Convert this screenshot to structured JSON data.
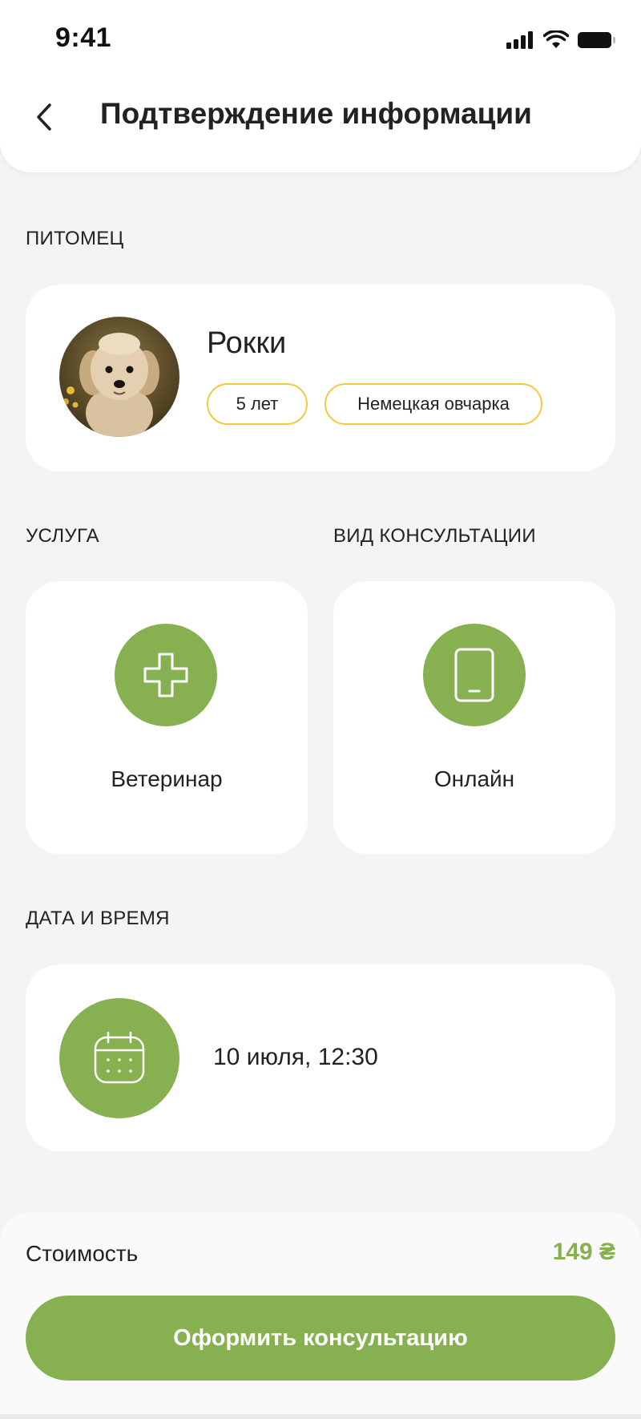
{
  "status_bar": {
    "time": "9:41"
  },
  "header": {
    "title": "Подтверждение информации"
  },
  "pet_section": {
    "label": "ПИТОМЕЦ",
    "name": "Рокки",
    "tags": [
      "5 лет",
      "Немецкая овчарка"
    ]
  },
  "service_section": {
    "label": "УСЛУГА",
    "value": "Ветеринар",
    "icon": "medical-cross-icon"
  },
  "consultation_section": {
    "label": "ВИД КОНСУЛЬТАЦИИ",
    "value": "Онлайн",
    "icon": "phone-icon"
  },
  "datetime_section": {
    "label": "ДАТА И ВРЕМЯ",
    "value": "10 июля, 12:30",
    "icon": "calendar-icon"
  },
  "footer": {
    "cost_label": "Стоимость",
    "cost_value": "149 ₴",
    "cta_label": "Оформить консультацию"
  },
  "colors": {
    "accent": "#87b050",
    "tag_border": "#f0c93e",
    "background": "#f4f4f6"
  }
}
